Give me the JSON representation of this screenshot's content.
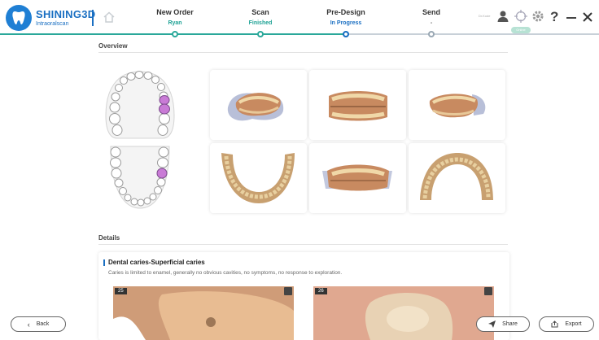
{
  "app": {
    "brand": "SHINING3D",
    "product": "Intraoralscan",
    "user_label": "Dr.Kode",
    "status_pill": "Online"
  },
  "steps": [
    {
      "title": "New Order",
      "status": "Ryan"
    },
    {
      "title": "Scan",
      "status": "Finished"
    },
    {
      "title": "Pre-Design",
      "status": "In Progress"
    },
    {
      "title": "Send",
      "status": "-"
    }
  ],
  "icons": [
    "home-icon",
    "user-icon",
    "crosshair-icon",
    "settings-icon",
    "help-icon",
    "minimize-icon",
    "close-icon"
  ],
  "overview": {
    "title": "Overview",
    "highlight_color": "#c97bd6",
    "thumbnails": [
      "upper-front-view",
      "bite-front-view",
      "upper-right-view",
      "lower-occlusal-view",
      "bite-frontal-view",
      "upper-occlusal-view"
    ]
  },
  "details": {
    "title": "Details",
    "finding_title": "Dental caries-Superficial  caries",
    "finding_desc": "Caries is limited to enamel, generally no obvious cavities, no symptoms, no response to exploration.",
    "photos": [
      {
        "tooth": "25"
      },
      {
        "tooth": "26"
      }
    ]
  },
  "buttons": {
    "back": "Back",
    "share": "Share",
    "export": "Export"
  },
  "colors": {
    "brand_blue": "#1a6fc2",
    "teal": "#1ea295",
    "caries_highlight": "#c97bd6"
  }
}
